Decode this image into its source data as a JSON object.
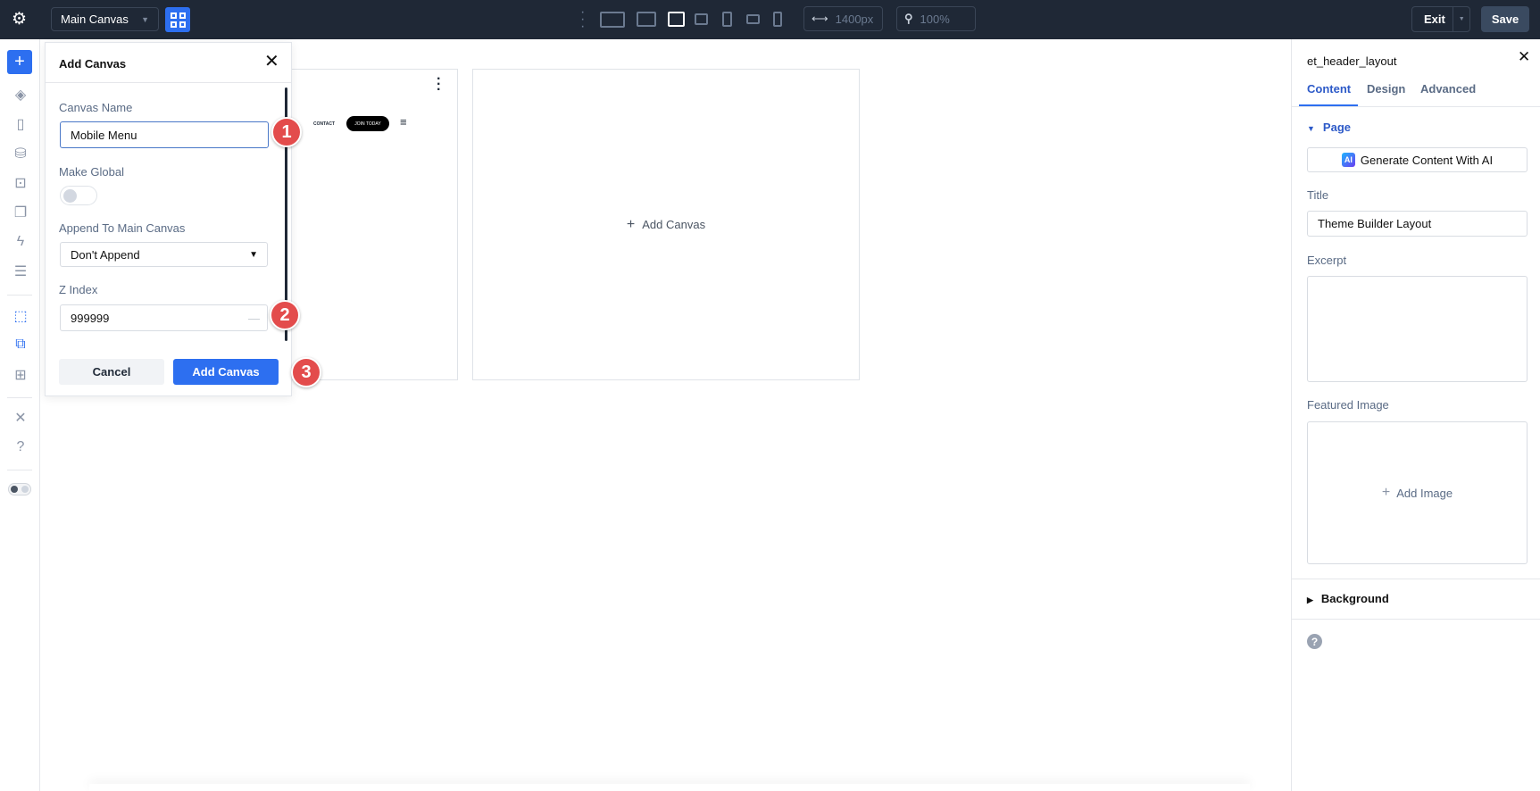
{
  "topbar": {
    "canvas_select": "Main Canvas",
    "width_value": "1400px",
    "zoom_value": "100%",
    "exit_label": "Exit",
    "save_label": "Save",
    "accent": "#2d6ff0"
  },
  "canvas": {
    "preview_nav": {
      "contact": "CONTACT",
      "join": "JOIN TODAY"
    },
    "add_canvas_label": "Add Canvas"
  },
  "dialog": {
    "title": "Add Canvas",
    "canvas_name_label": "Canvas Name",
    "canvas_name_value": "Mobile Menu",
    "make_global_label": "Make Global",
    "append_label": "Append To Main Canvas",
    "append_value": "Don't Append",
    "z_index_label": "Z Index",
    "z_index_value": "999999",
    "cancel_label": "Cancel",
    "submit_label": "Add Canvas"
  },
  "callouts": [
    "1",
    "2",
    "3"
  ],
  "panel": {
    "title": "et_header_layout",
    "tabs": [
      {
        "label": "Content"
      },
      {
        "label": "Design"
      },
      {
        "label": "Advanced"
      }
    ],
    "section_page": "Page",
    "ai_badge": "AI",
    "ai_button": "Generate Content With AI",
    "title_label": "Title",
    "title_value": "Theme Builder Layout",
    "excerpt_label": "Excerpt",
    "excerpt_value": "",
    "featured_label": "Featured Image",
    "add_image_label": "Add Image",
    "section_background": "Background"
  }
}
